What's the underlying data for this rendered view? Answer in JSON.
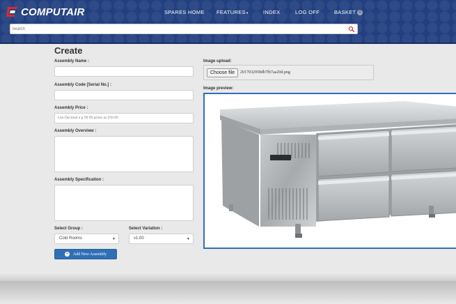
{
  "brand": {
    "name": "COMPUTAIR",
    "accent": "#e02828",
    "header_color": "#22407f"
  },
  "nav": {
    "spares_home": "SPARES HOME",
    "features": "FEATURES",
    "features_caret": "▾",
    "index": "INDEX",
    "log_off": "LOG OFF",
    "basket": "BASKET",
    "basket_count": "0"
  },
  "search": {
    "placeholder": "Search",
    "icon": "search-icon"
  },
  "page": {
    "title": "Create"
  },
  "form": {
    "assembly_name_label": "Assembly Name :",
    "assembly_name_value": "",
    "assembly_code_label": "Assembly Code [Serial No.] :",
    "assembly_code_value": "",
    "assembly_price_label": "Assembly Price :",
    "assembly_price_placeholder": "Use Decimal e.g 99.99 prints as £99.99",
    "assembly_overview_label": "Assembly Overview :",
    "assembly_overview_value": "",
    "assembly_spec_label": "Assembly Specification :",
    "assembly_spec_value": "",
    "group_label": "Select Group :",
    "group_value": "Cold Rooms",
    "variation_label": "Select Variation :",
    "variation_value": "v1.00",
    "add_button": "Add New Assembly"
  },
  "upload": {
    "label": "Image upload:",
    "choose_button": "Choose file",
    "file_name": "2017032958db7fb7aa20d.png",
    "preview_label": "Image preview:"
  }
}
